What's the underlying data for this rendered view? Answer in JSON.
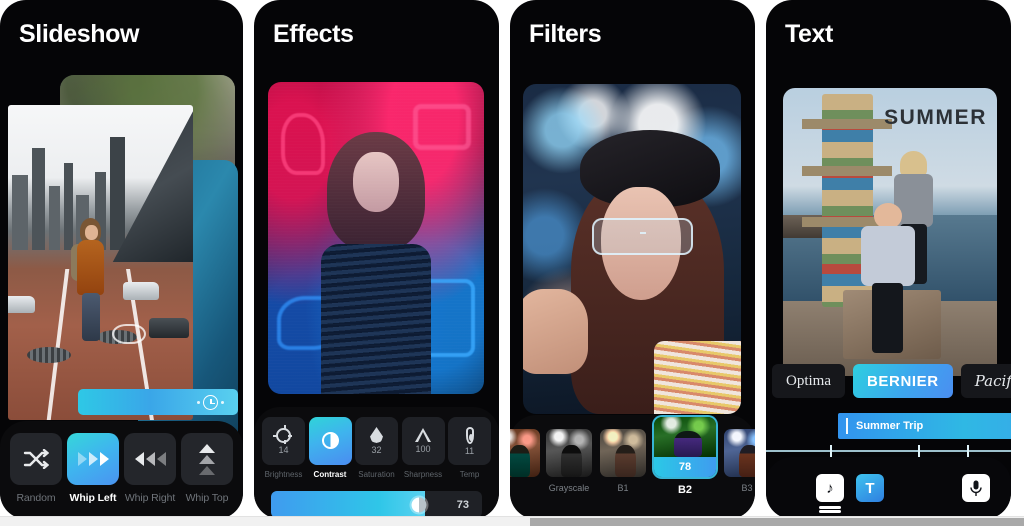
{
  "panels": [
    {
      "title": "Slideshow",
      "timeline": {
        "icon": "clock-icon"
      },
      "transitions": [
        {
          "label": "Random",
          "icon": "shuffle-icon",
          "active": false
        },
        {
          "label": "Whip Left",
          "icon": "whip-left-icon",
          "active": true
        },
        {
          "label": "Whip Right",
          "icon": "whip-right-icon",
          "active": false
        },
        {
          "label": "Whip Top",
          "icon": "whip-top-icon",
          "active": false
        }
      ]
    },
    {
      "title": "Effects",
      "adjustments": [
        {
          "label": "Brightness",
          "value": "14",
          "icon": "sun-icon",
          "active": false
        },
        {
          "label": "Contrast",
          "value": "",
          "icon": "contrast-icon",
          "active": true
        },
        {
          "label": "Saturation",
          "value": "32",
          "icon": "droplet-icon",
          "active": false
        },
        {
          "label": "Sharpness",
          "value": "100",
          "icon": "triangle-icon",
          "active": false
        },
        {
          "label": "Temp",
          "value": "11",
          "icon": "thermometer-icon",
          "active": false
        }
      ],
      "slider": {
        "value": "73",
        "percent": 73
      }
    },
    {
      "title": "Filters",
      "filters": [
        {
          "name": "",
          "active": false,
          "class": "t-edge"
        },
        {
          "name": "Grayscale",
          "active": false,
          "class": "t-gray"
        },
        {
          "name": "B1",
          "active": false,
          "class": "t-b1"
        },
        {
          "name": "B2",
          "active": true,
          "value": "78",
          "class": "t-b2"
        },
        {
          "name": "B3",
          "active": false,
          "class": "t-b3"
        },
        {
          "name": "",
          "active": false,
          "class": "t-edge"
        }
      ]
    },
    {
      "title": "Text",
      "overlay_text": "SUMMER",
      "fonts": [
        {
          "label": "Optima",
          "active": false
        },
        {
          "label": "BERNIER",
          "active": true
        },
        {
          "label": "Pacifico",
          "active": false
        }
      ],
      "clip": {
        "label": "Summer Trip"
      },
      "tools": [
        {
          "icon": "music-icon",
          "label": "♪",
          "active": false
        },
        {
          "icon": "text-icon",
          "label": "T",
          "active": true
        },
        {
          "icon": "microphone-icon",
          "label": "⬤",
          "active": false
        }
      ]
    }
  ],
  "colors": {
    "accent_cyan": "#2ec8e6",
    "accent_blue": "#3f9bef",
    "panel_bg": "#050507",
    "bar_bg": "#0b0b0d"
  }
}
